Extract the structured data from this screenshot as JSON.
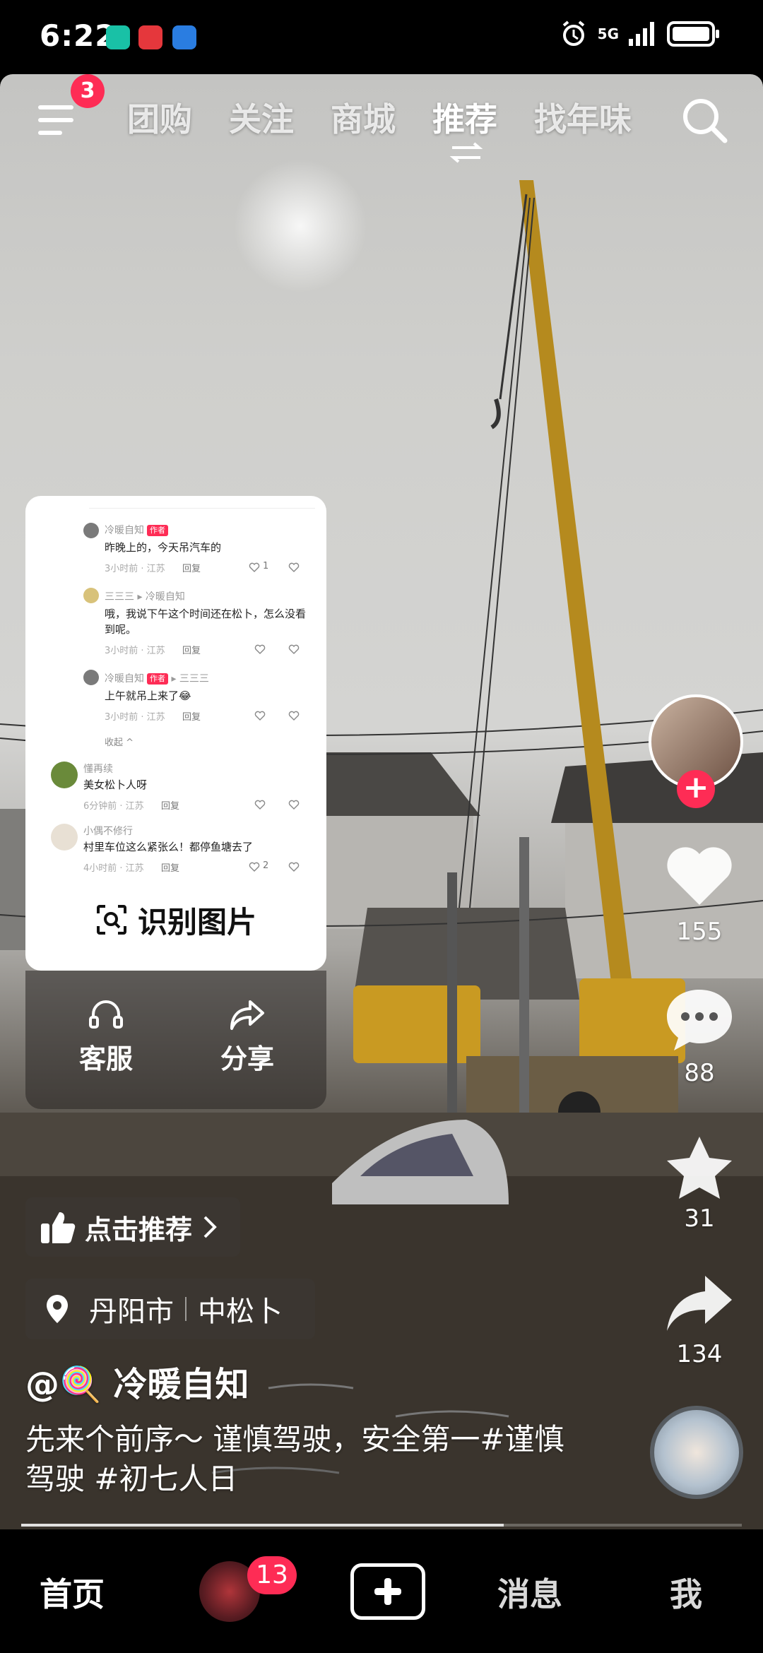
{
  "status_bar": {
    "time": "6:22",
    "network": "5G"
  },
  "top_nav": {
    "menu_badge": "3",
    "tabs": [
      "团购",
      "关注",
      "商城",
      "推荐",
      "找年味"
    ],
    "active_tab": "推荐"
  },
  "comment_card": {
    "comments": [
      {
        "name": "冷暖自知",
        "tag": "作者",
        "text": "昨晚上的，今天吊汽车的",
        "meta": "3小时前 · 江苏",
        "reply": "回复",
        "likes": "1"
      },
      {
        "name": "三三三 ▸ 冷暖自知",
        "text": "哦，我说下午这个时间还在松卜，怎么没看到呢。",
        "meta": "3小时前 · 江苏",
        "reply": "回复",
        "likes": ""
      },
      {
        "name": "冷暖自知",
        "tag": "作者",
        "reply_to": "▸ 三三三",
        "text": "上午就吊上来了😂",
        "meta": "3小时前 · 江苏",
        "reply": "回复",
        "likes": ""
      },
      {
        "name": "懂再续",
        "text": "美女松卜人呀",
        "meta": "6分钟前 · 江苏",
        "reply": "回复",
        "likes": ""
      },
      {
        "name": "小偶不修行",
        "text": "村里车位这么紧张么！都停鱼塘去了",
        "meta": "4小时前 · 江苏",
        "reply": "回复",
        "likes": "2"
      }
    ],
    "collapse_label": "收起 ^",
    "recognize_label": "识别图片"
  },
  "action_panel": {
    "service_label": "客服",
    "share_label": "分享"
  },
  "right_rail": {
    "likes": "155",
    "comments": "88",
    "favorites": "31",
    "shares": "134"
  },
  "recommend_pill": {
    "label": "点击推荐"
  },
  "location_pill": {
    "city": "丹阳市",
    "place": "中松卜"
  },
  "video_info": {
    "author": "@🍭 冷暖自知",
    "caption": "先来个前序～ 谨慎驾驶，安全第一#谨慎驾驶 #初七人日",
    "progress": 0.67
  },
  "bottom_nav": {
    "home": "首页",
    "badge": "13",
    "messages": "消息",
    "me": "我"
  },
  "colors": {
    "accent": "#fe2c55",
    "background": "#000000"
  }
}
